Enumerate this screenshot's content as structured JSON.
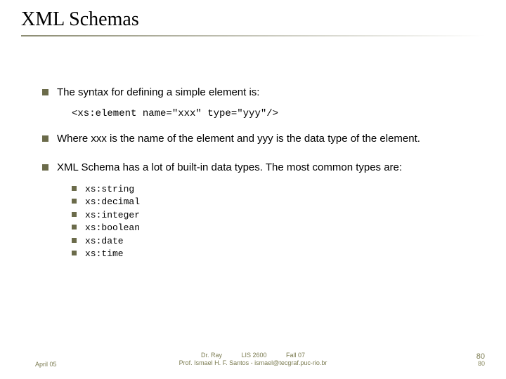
{
  "title": "XML Schemas",
  "bullets": {
    "b1": "The syntax for defining a simple element is:",
    "code": "<xs:element name=\"xxx\" type=\"yyy\"/>",
    "b2": "Where xxx is the name of the element and yyy is the data type of the element.",
    "b3": "XML Schema has a lot of built-in data types. The most common types are:"
  },
  "datatypes": [
    "xs:string",
    "xs:decimal",
    "xs:integer",
    "xs:boolean",
    "xs:date",
    "xs:time"
  ],
  "footer": {
    "left": "April 05",
    "center_line1": "Dr. Ray           LIS 2600           Fall 07",
    "center_line2": "Prof. Ismael H. F. Santos - ismael@tecgraf.puc-rio.br",
    "page_a": "80",
    "page_b": "80"
  }
}
